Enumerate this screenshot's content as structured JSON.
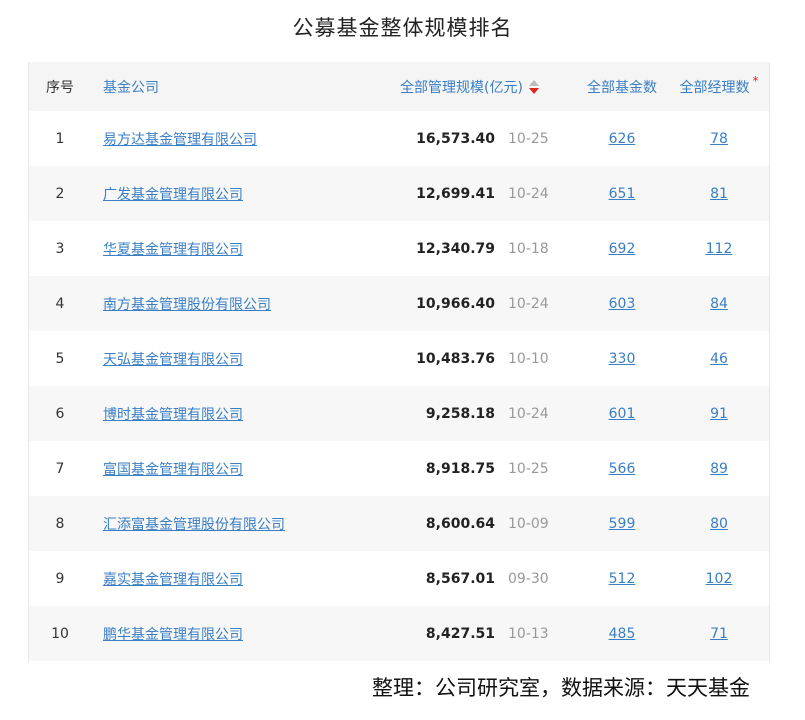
{
  "title": "公募基金整体规模排名",
  "header": {
    "index": "序号",
    "company": "基金公司",
    "scale": "全部管理规模(亿元)",
    "funds": "全部基金数",
    "managers": "全部经理数",
    "managers_mark": "*"
  },
  "colors": {
    "link": "#3a7fc4",
    "sort_active": "#e0251b",
    "sort_inactive": "#bbbbbb",
    "date": "#999999"
  },
  "icons": {
    "sort": "sort-desc-icon",
    "required": "asterisk-icon"
  },
  "rows": [
    {
      "index": "1",
      "company": "易方达基金管理有限公司",
      "scale": "16,573.40",
      "date": "10-25",
      "funds": "626",
      "managers": "78"
    },
    {
      "index": "2",
      "company": "广发基金管理有限公司",
      "scale": "12,699.41",
      "date": "10-24",
      "funds": "651",
      "managers": "81"
    },
    {
      "index": "3",
      "company": "华夏基金管理有限公司",
      "scale": "12,340.79",
      "date": "10-18",
      "funds": "692",
      "managers": "112"
    },
    {
      "index": "4",
      "company": "南方基金管理股份有限公司",
      "scale": "10,966.40",
      "date": "10-24",
      "funds": "603",
      "managers": "84"
    },
    {
      "index": "5",
      "company": "天弘基金管理有限公司",
      "scale": "10,483.76",
      "date": "10-10",
      "funds": "330",
      "managers": "46"
    },
    {
      "index": "6",
      "company": "博时基金管理有限公司",
      "scale": "9,258.18",
      "date": "10-24",
      "funds": "601",
      "managers": "91"
    },
    {
      "index": "7",
      "company": "富国基金管理有限公司",
      "scale": "8,918.75",
      "date": "10-25",
      "funds": "566",
      "managers": "89"
    },
    {
      "index": "8",
      "company": "汇添富基金管理股份有限公司",
      "scale": "8,600.64",
      "date": "10-09",
      "funds": "599",
      "managers": "80"
    },
    {
      "index": "9",
      "company": "嘉实基金管理有限公司",
      "scale": "8,567.01",
      "date": "09-30",
      "funds": "512",
      "managers": "102"
    },
    {
      "index": "10",
      "company": "鹏华基金管理有限公司",
      "scale": "8,427.51",
      "date": "10-13",
      "funds": "485",
      "managers": "71"
    }
  ],
  "footer": "整理：公司研究室，数据来源：天天基金"
}
